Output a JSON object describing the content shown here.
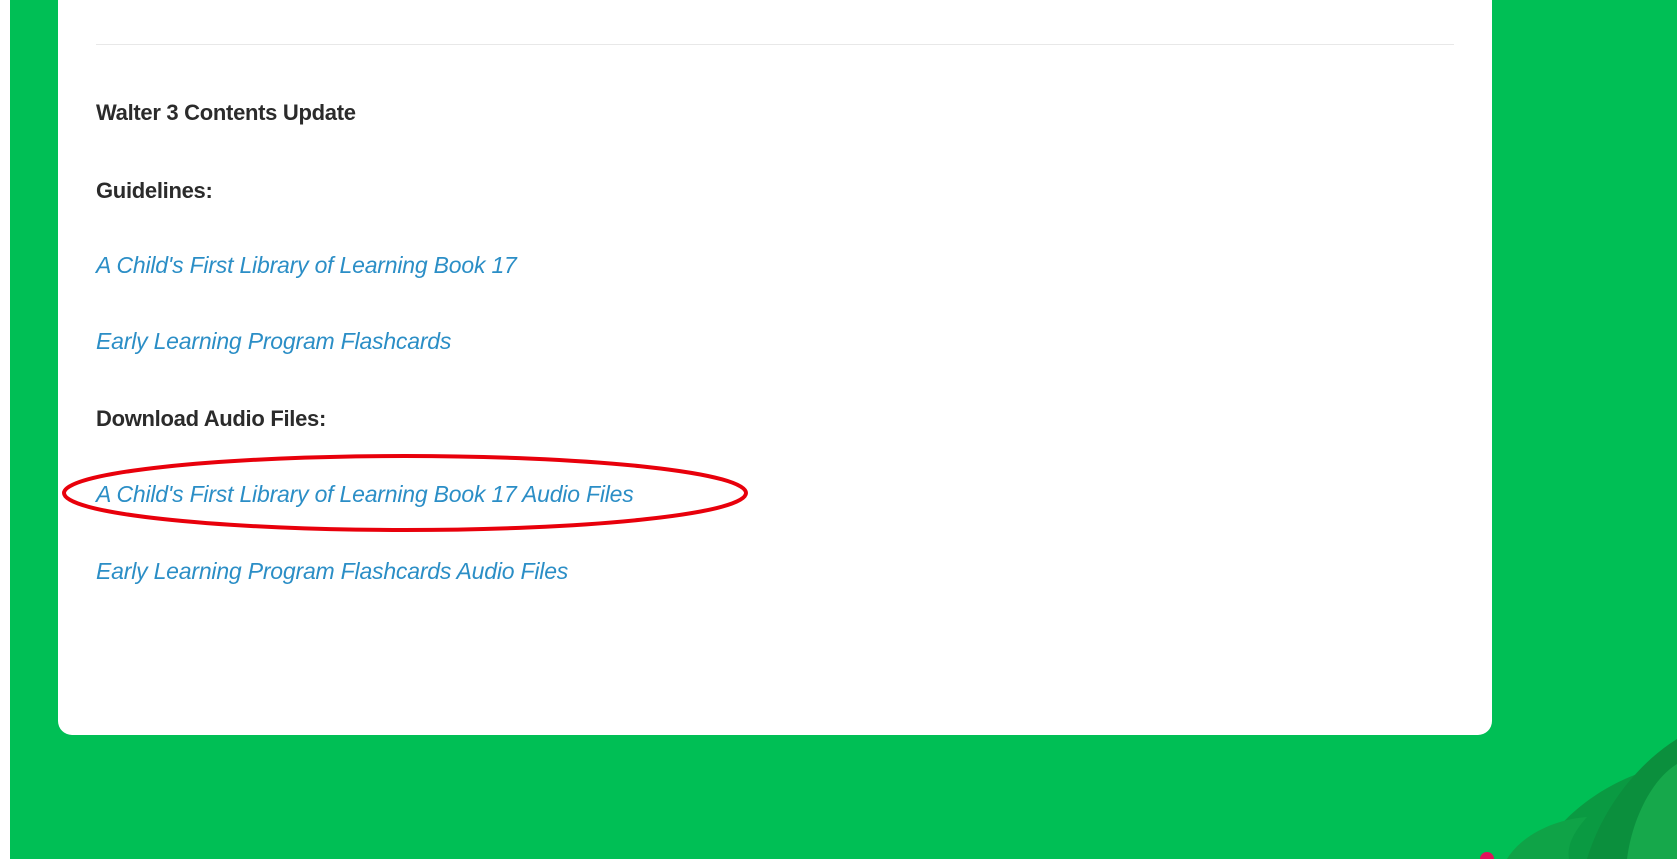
{
  "content": {
    "title": "Walter 3  Contents Update",
    "guidelines_label": "Guidelines:",
    "guideline_links": [
      "A Child's First Library of Learning Book 17",
      "Early Learning Program Flashcards"
    ],
    "audio_label": "Download Audio Files:",
    "audio_links": [
      "A Child's First Library of Learning Book 17 Audio Files",
      "Early Learning Program Flashcards Audio Files"
    ]
  },
  "colors": {
    "background_green": "#00bf55",
    "link_blue": "#2b8ec6",
    "heading_text": "#2b2b2b",
    "highlight_red": "#e8000b"
  }
}
